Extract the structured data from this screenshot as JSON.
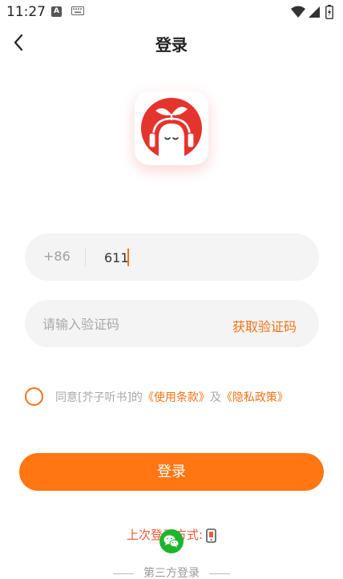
{
  "status_bar": {
    "time": "11:27",
    "a_icon_label": "A"
  },
  "header": {
    "title": "登录"
  },
  "phone": {
    "country_code": "+86",
    "value": "611"
  },
  "code": {
    "placeholder": "请输入验证码",
    "get_code_label": "获取验证码"
  },
  "agreement": {
    "prefix": "同意[芥子听书]的",
    "terms_link": "《使用条款》",
    "conjunction": "及",
    "privacy_link": "《隐私政策》"
  },
  "login_button": {
    "label": "登录"
  },
  "last_login": {
    "label": "上次登录方式:"
  },
  "third_party": {
    "label": "第三方登录"
  },
  "colors": {
    "accent": "#ff7612",
    "link": "#f07317",
    "logo_red": "#e5332d",
    "wechat": "#1db52c"
  }
}
